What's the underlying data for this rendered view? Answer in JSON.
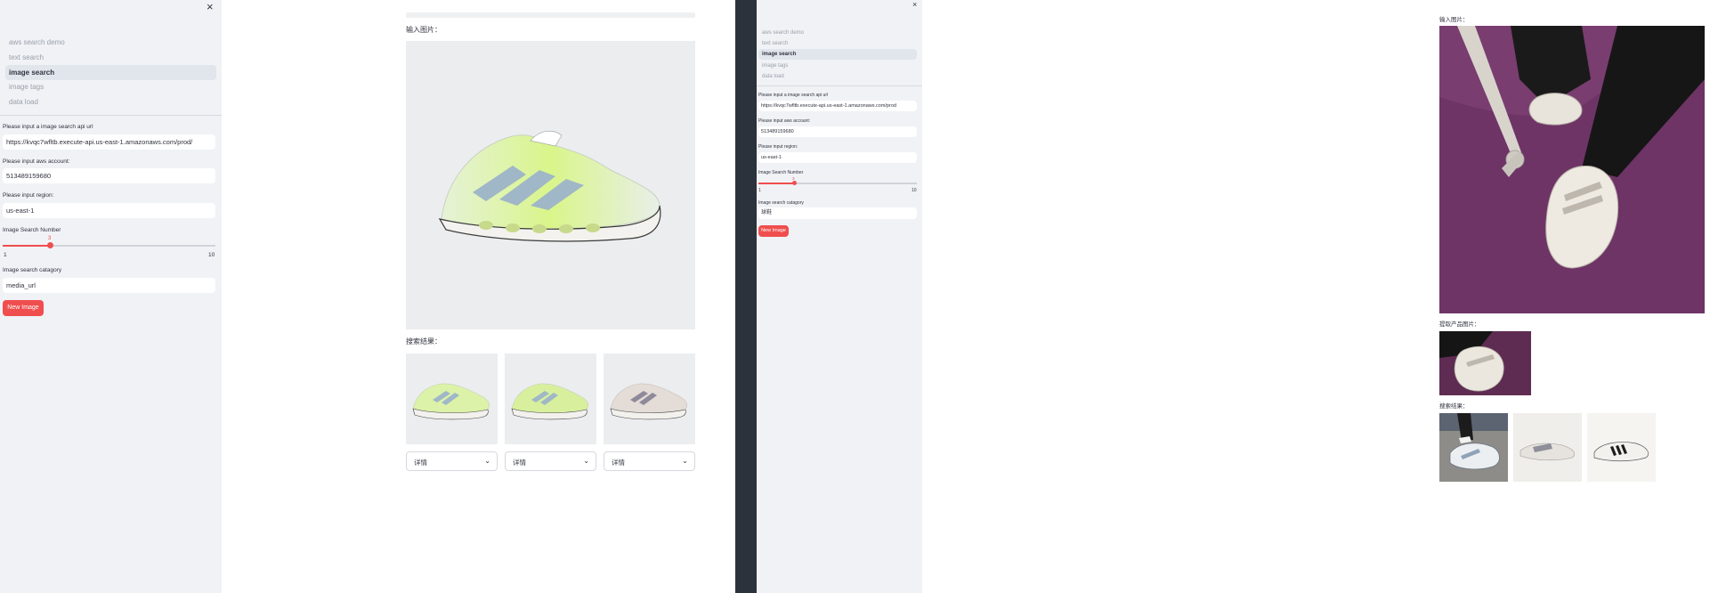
{
  "sidebar": {
    "nav_items": [
      {
        "label": "aws search demo"
      },
      {
        "label": "text search"
      },
      {
        "label": "image search"
      },
      {
        "label": "image tags"
      },
      {
        "label": "data load"
      }
    ],
    "api_url": {
      "label": "Please input a image search api url",
      "value": "https://kvqc7wfltb.execute-api.us-east-1.amazonaws.com/prod/"
    },
    "api_url_right": {
      "value": "https://kvqc7wfltb.execute-api.us-east-1.amazonaws.com/prod"
    },
    "account": {
      "label": "Please input aws account:",
      "value": "513489159680"
    },
    "region": {
      "label": "Please input region:",
      "value": "us-east-1"
    },
    "slider": {
      "label": "Image Search Number",
      "min": "1",
      "max": "10",
      "value": "3",
      "fraction": 0.222
    },
    "category": {
      "label": "Image search catagory",
      "value_left": "media_url",
      "value_right": "球鞋"
    },
    "button": {
      "label": "New Image"
    },
    "close_glyph": "×"
  },
  "main_left": {
    "input_image_label": "输入图片：",
    "results_label": "搜索结果：",
    "detail_label": "详情"
  },
  "main_right": {
    "input_image_label": "输入图片：",
    "extracted_label": "提取产品图片：",
    "results_label": "搜索结果："
  },
  "colors": {
    "accent": "#f04e4e",
    "sidebar_bg": "#f0f2f6",
    "image_bg": "#ebedef",
    "divider_bg": "#2b323c"
  }
}
